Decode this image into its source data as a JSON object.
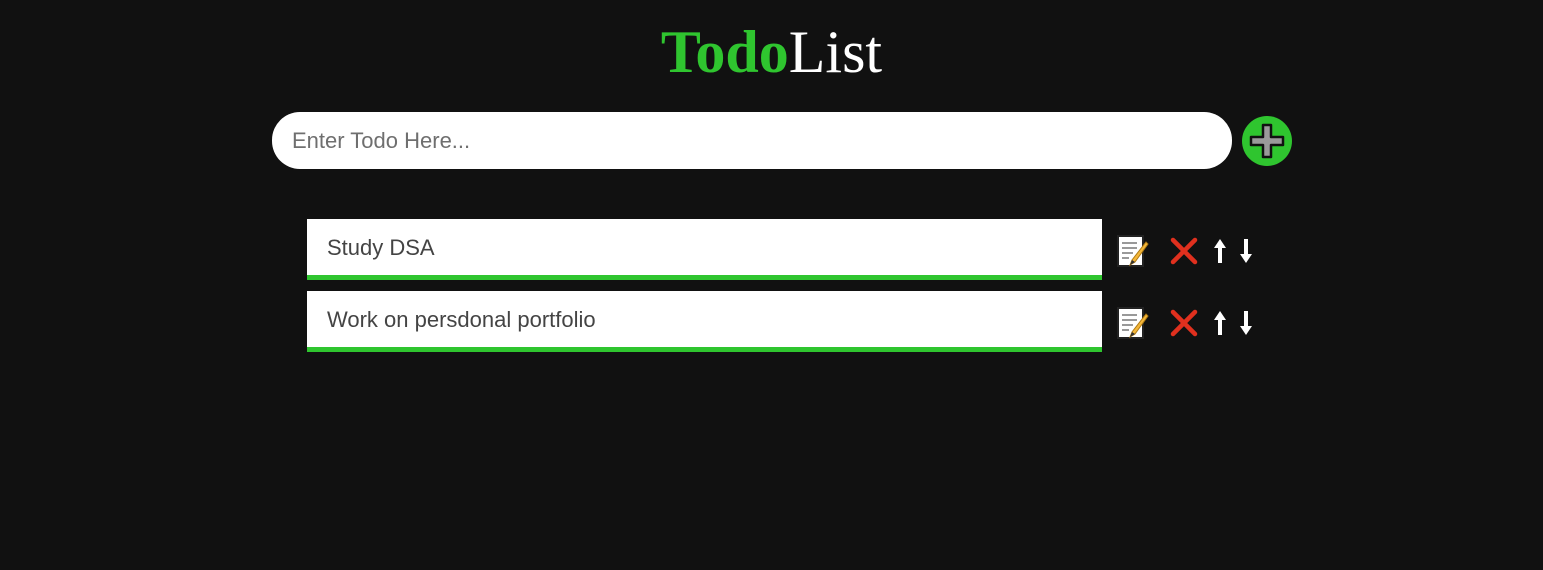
{
  "header": {
    "title_accent": "Todo",
    "title_rest": "List"
  },
  "input": {
    "placeholder": "Enter Todo Here...",
    "value": ""
  },
  "icons": {
    "add": "plus-circle-icon",
    "edit": "memo-icon",
    "delete": "cross-mark-icon",
    "move_up": "arrow-up-icon",
    "move_down": "arrow-down-icon"
  },
  "colors": {
    "background": "#111111",
    "accent": "#2fc52f",
    "delete": "#e0301e",
    "text": "#444444"
  },
  "todos": [
    {
      "text": "Study DSA"
    },
    {
      "text": "Work on persdonal portfolio"
    }
  ]
}
